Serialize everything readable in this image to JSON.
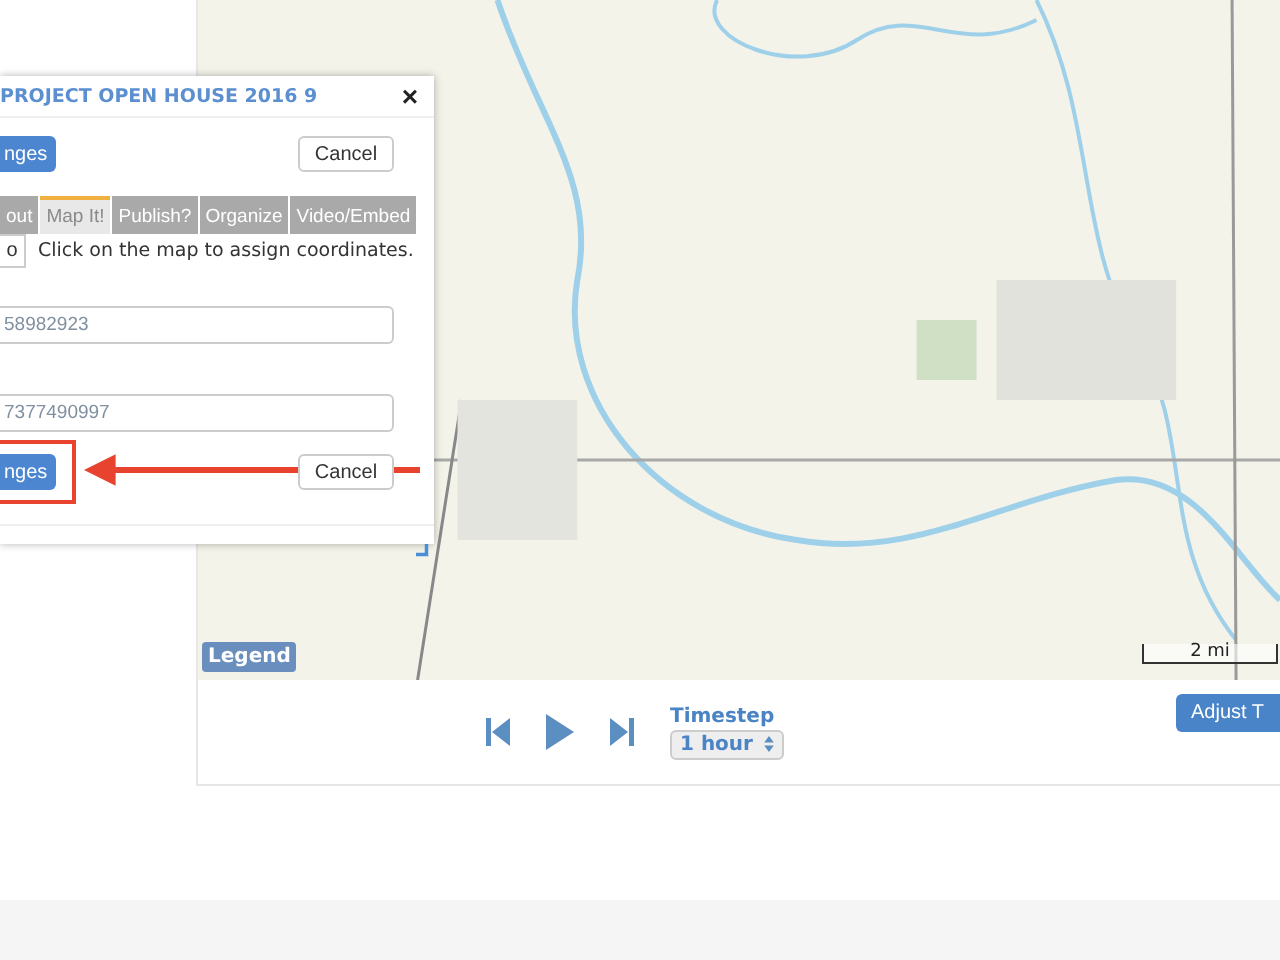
{
  "map": {
    "legend_button": "Legend",
    "scale_label": "2 mi"
  },
  "playback": {
    "timestep_label": "Timestep",
    "timestep_value": "1 hour",
    "adjust_button": "Adjust T"
  },
  "dialog": {
    "title": "PROJECT OPEN HOUSE 2016 9",
    "close": "×",
    "save_button": "nges",
    "cancel_button": "Cancel",
    "tabs": [
      {
        "label": "out",
        "selected": false
      },
      {
        "label": "Map It!",
        "selected": true
      },
      {
        "label": "Publish?",
        "selected": false
      },
      {
        "label": "Organize",
        "selected": false
      },
      {
        "label": "Video/Embed",
        "selected": false
      }
    ],
    "map_button": "o",
    "instruction": "Click on the map to assign coordinates.",
    "fields": [
      {
        "value": "58982923"
      },
      {
        "value": "7377490997"
      }
    ],
    "bottom_save_button": "nges",
    "bottom_cancel_button": "Cancel"
  }
}
